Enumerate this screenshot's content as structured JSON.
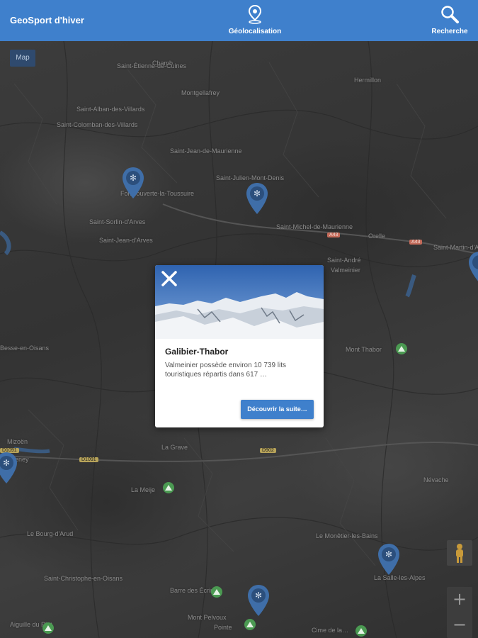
{
  "appbar": {
    "title": "GeoSport d'hiver",
    "geolocation_label": "Géolocalisation",
    "search_label": "Recherche",
    "color": "#3f80cc"
  },
  "map": {
    "type_button": "Map",
    "zoom_in": "+",
    "zoom_out": "−",
    "places": [
      "Chamb…",
      "Saint-Étienne-de-Cuines",
      "Montgellafrey",
      "Saint-Alban-des-Villards",
      "Saint-Colomban-des-Villards",
      "Hermillon",
      "Saint-Jean-de-Maurienne",
      "Saint-Julien-Mont-Denis",
      "Fontcouverte-la-Toussuire",
      "Saint-Sorlin-d'Arves",
      "Saint-Michel-de-Maurienne",
      "Saint-Jean-d'Arves",
      "Orelle",
      "Saint-Martin-d'Arc",
      "Saint-André",
      "Valmeinier",
      "Mont Thabor",
      "Besse-en-Oisans",
      "Mizoën",
      "Le Freney",
      "La Grave",
      "La Meije",
      "Névache",
      "La Salle-les-Alpes",
      "Le Monêtier-les-Bains",
      "Saint-Christophe-en-Oisans",
      "Barre des Écrins",
      "Mont Pelvoux",
      "Pointe",
      "Aiguille du Plat",
      "Cime de la…",
      "Le Bourg-d'Arud"
    ],
    "road_labels": [
      "A43",
      "A43",
      "D1091",
      "D1091",
      "D902"
    ],
    "pin_color": "#3f6ea8",
    "peak_color": "#4b9a52"
  },
  "popup": {
    "title": "Galibier-Thabor",
    "description": "Valmeinier possède environ 10 739 lits touristiques répartis dans 617 …",
    "button_label": "Découvrir la suite…",
    "close_icon": "close-icon"
  }
}
